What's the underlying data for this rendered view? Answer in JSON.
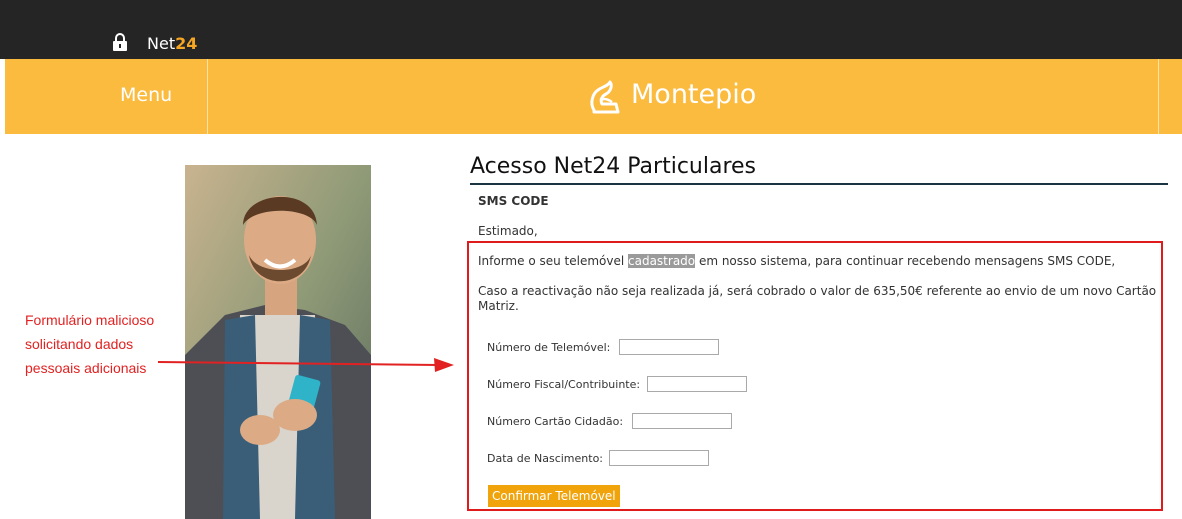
{
  "topbar": {
    "brand_prefix": "Net",
    "brand_suffix": "24",
    "lock_icon": "lock-icon"
  },
  "header": {
    "menu_label": "Menu",
    "logo_text": "Montepio",
    "logo_icon": "montepio-logo-icon",
    "bg_color": "#fbbb3f"
  },
  "page": {
    "title": "Acesso Net24 Particulares",
    "section_label": "SMS CODE",
    "greeting": "Estimado,",
    "paragraph1_before": "Informe o seu telemóvel ",
    "paragraph1_highlight": "cadastrado",
    "paragraph1_after": " em nosso sistema, para continuar recebendo mensagens SMS CODE,",
    "paragraph2": "Caso a reactivação não seja realizada já, será cobrado o valor de 635,50€ referente ao envio de um novo Cartão Matriz."
  },
  "form": {
    "fields": [
      {
        "label": "Número de Telemóvel:",
        "value": ""
      },
      {
        "label": "Número Fiscal/Contribuinte:",
        "value": ""
      },
      {
        "label": "Número Cartão Cidadão:",
        "value": ""
      },
      {
        "label": "Data de Nascimento:",
        "value": ""
      }
    ],
    "submit_label": "Confirmar Telemóvel",
    "submit_color": "#f0a30a"
  },
  "annotation": {
    "text": "Formulário malicioso solicitando dados pessoais adicionais",
    "color": "#e22222"
  }
}
